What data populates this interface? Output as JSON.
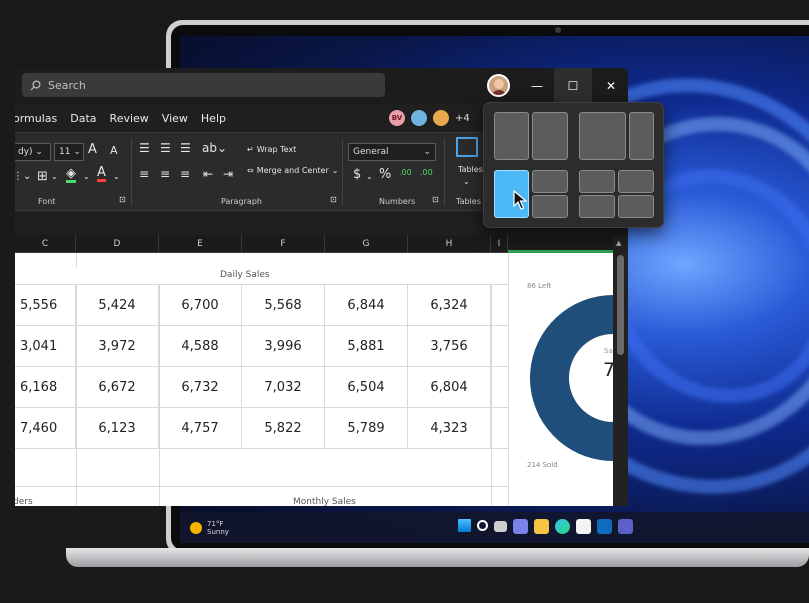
{
  "excel": {
    "search_placeholder": "Search",
    "window_controls": {
      "minimize": "—",
      "maximize": "☐",
      "close": "✕"
    },
    "menu": [
      "ormulas",
      "Data",
      "Review",
      "View",
      "Help"
    ],
    "collaborators": {
      "initials": "BV",
      "more": "+4"
    },
    "ribbon": {
      "font_name": "dy)",
      "font_size": "11",
      "grow_font": "A",
      "shrink_font": "A",
      "wrap_text": "Wrap Text",
      "merge_center": "Merge and Center",
      "number_format": "General",
      "currency": "$",
      "percent": "%",
      "increase_decimal": ".00",
      "decrease_decimal": ".00",
      "tables": "Tables",
      "groups": {
        "font": "Font",
        "paragraph": "Paragraph",
        "numbers": "Numbers",
        "tables": "Tables"
      }
    },
    "columns": [
      "C",
      "D",
      "E",
      "F",
      "G",
      "H",
      "I"
    ],
    "sheet": {
      "table_title": "Daily Sales",
      "rows": [
        [
          "5,556",
          "5,424",
          "6,700",
          "5,568",
          "6,844",
          "6,324"
        ],
        [
          "3,041",
          "3,972",
          "4,588",
          "3,996",
          "5,881",
          "3,756"
        ],
        [
          "6,168",
          "6,672",
          "6,732",
          "7,032",
          "6,504",
          "6,804"
        ],
        [
          "7,460",
          "6,123",
          "4,757",
          "5,822",
          "5,789",
          "4,323"
        ]
      ],
      "footer_left": "ders",
      "footer_center": "Monthly Sales"
    },
    "donut": {
      "left_label": "86 Left",
      "sold_label": "214 Sold",
      "center_small": "Sa",
      "center_big": "7"
    }
  },
  "chart_data": {
    "type": "pie",
    "categories": [
      "Left",
      "Sold"
    ],
    "values": [
      86,
      214
    ],
    "colors": [
      "#9fc3e7",
      "#1f4e7a"
    ]
  },
  "taskbar": {
    "temperature": "71°F",
    "condition": "Sunny"
  }
}
